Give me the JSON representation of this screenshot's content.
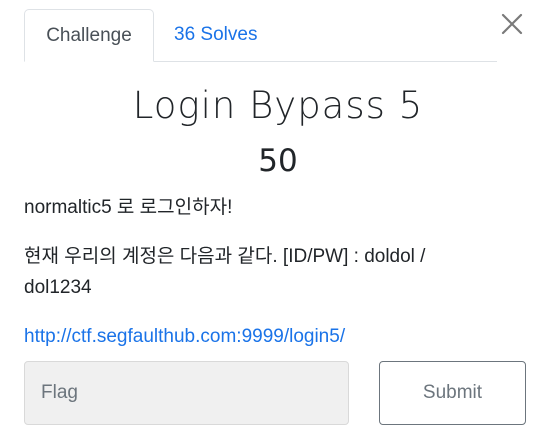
{
  "tabs": [
    {
      "label": "Challenge",
      "active": true
    },
    {
      "label": "36 Solves",
      "active": false
    }
  ],
  "challenge": {
    "title": "Login Bypass 5",
    "points": "50",
    "description_line1": "normaltic5 로 로그인하자!",
    "description_line2": "현재 우리의 계정은 다음과 같다. [ID/PW] : doldol / dol1234",
    "url": "http://ctf.segfaulthub.com:9999/login5/"
  },
  "form": {
    "flag_placeholder": "Flag",
    "flag_value": "",
    "submit_label": "Submit"
  },
  "icons": {
    "close": "close-icon"
  },
  "colors": {
    "link": "#1a73e8",
    "text": "#212529",
    "input_bg": "#f0f0f0",
    "button_border": "#6c757d"
  }
}
